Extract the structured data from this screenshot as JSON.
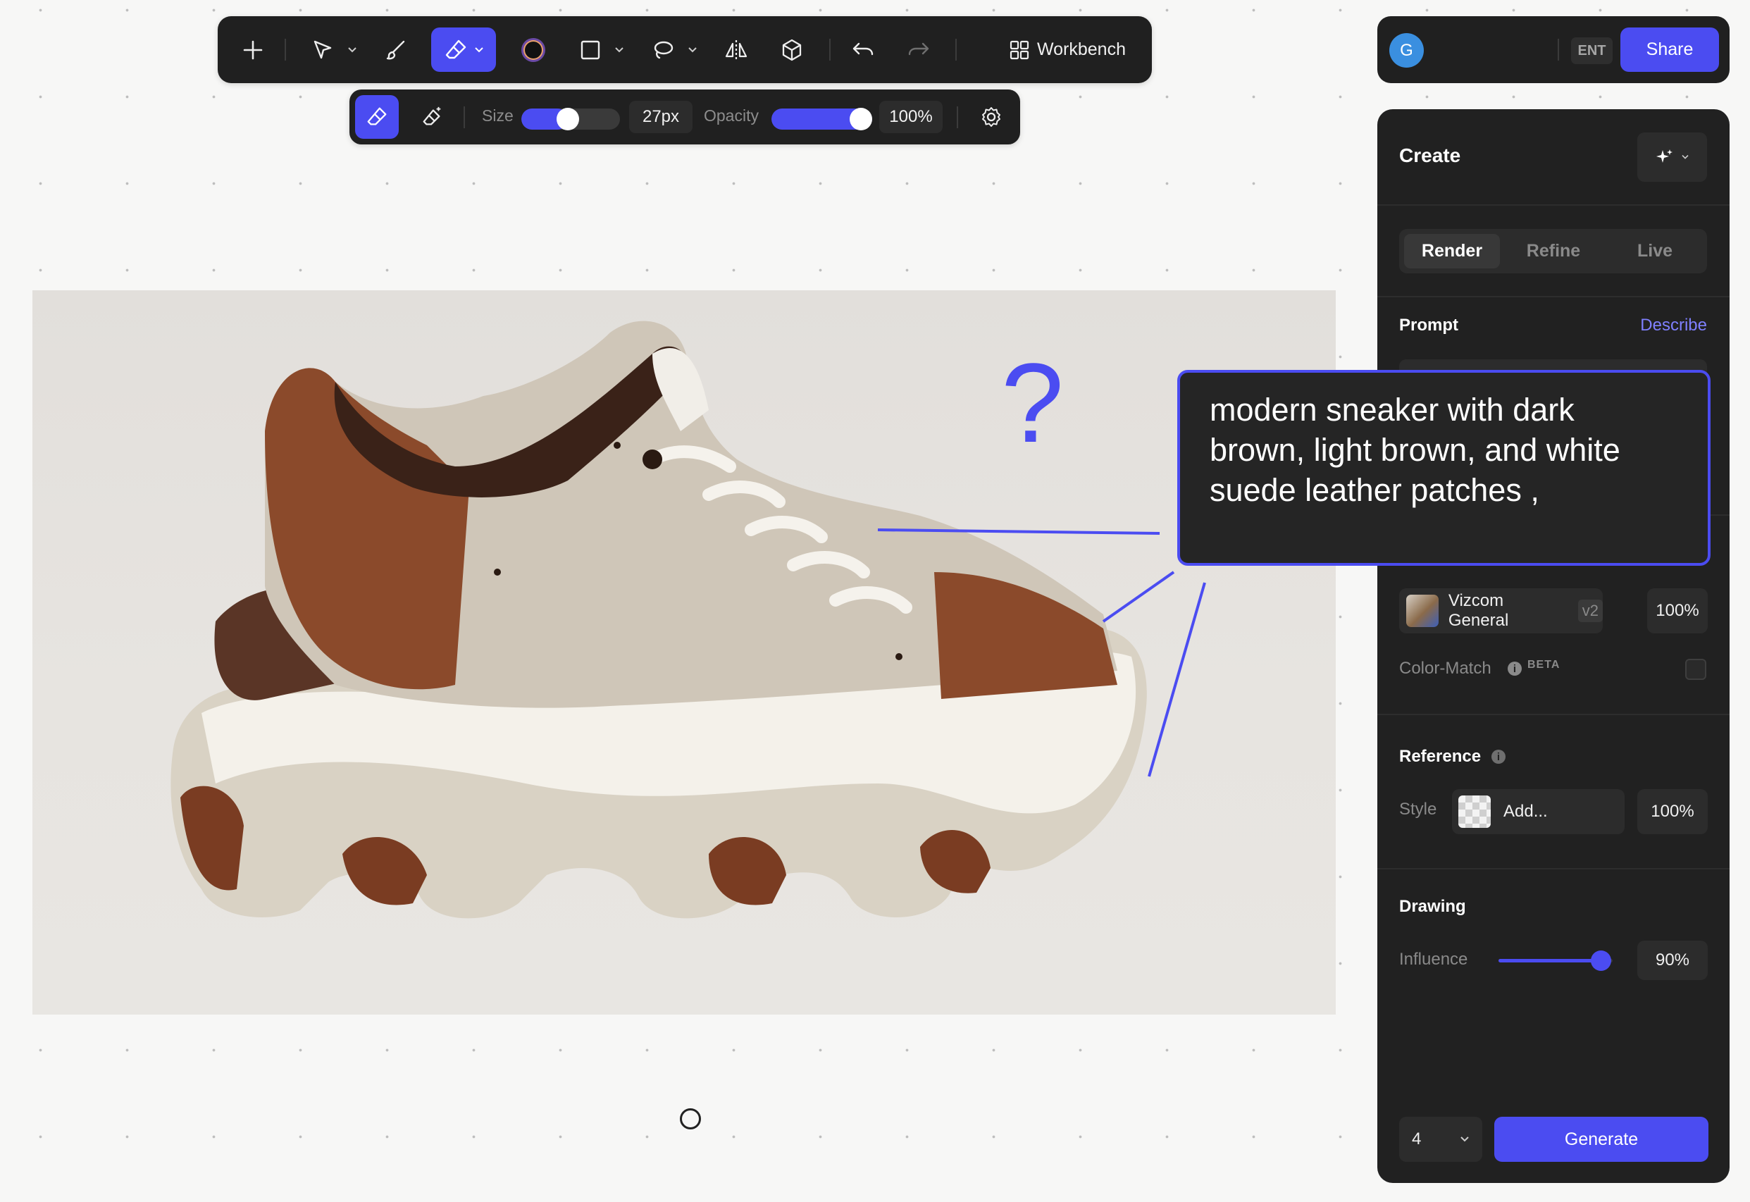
{
  "toolbar": {
    "workbench_label": "Workbench"
  },
  "brush_toolbar": {
    "size_label": "Size",
    "size_value": "27px",
    "size_level": 0.47,
    "opacity_label": "Opacity",
    "opacity_value": "100%",
    "opacity_level": 1.0
  },
  "user": {
    "avatar_initial": "G",
    "plan_badge": "ENT",
    "share_label": "Share"
  },
  "prompt_popup": {
    "text": "modern sneaker with dark brown, light brown, and white suede leather patches ,"
  },
  "canvas": {
    "annotation_glyph": "?"
  },
  "panel": {
    "title": "Create",
    "tabs": [
      {
        "label": "Render",
        "active": true
      },
      {
        "label": "Refine",
        "active": false
      },
      {
        "label": "Live",
        "active": false
      }
    ],
    "prompt_label": "Prompt",
    "describe_link": "Describe",
    "model": {
      "name": "Vizcom General",
      "version": "v2",
      "strength": "100%"
    },
    "color_match": {
      "label": "Color-Match",
      "badge": "BETA",
      "checked": false
    },
    "reference": {
      "title": "Reference",
      "style_label": "Style",
      "add_label": "Add...",
      "strength": "100%"
    },
    "drawing": {
      "title": "Drawing",
      "influence_label": "Influence",
      "influence_value": "90%",
      "influence_level": 0.9
    },
    "output_count": "4",
    "generate_label": "Generate"
  },
  "colors": {
    "accent": "#4b4cf1",
    "panel_bg": "#212121",
    "toolbar_bg": "#202020"
  }
}
